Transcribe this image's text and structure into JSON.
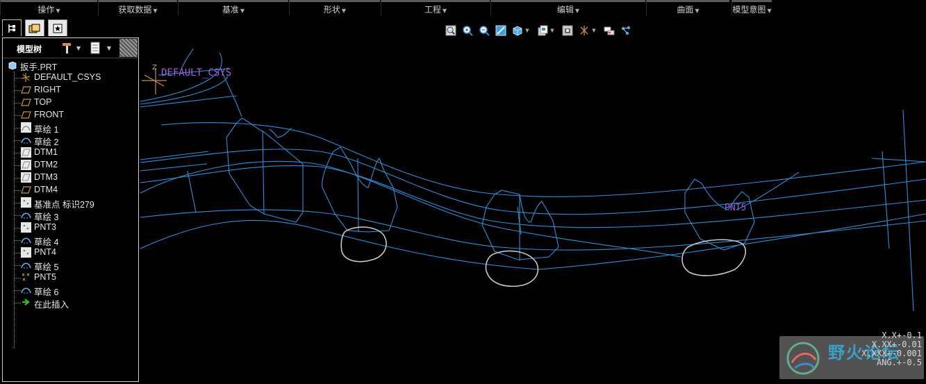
{
  "ribbon": {
    "groups": [
      "操作",
      "获取数据",
      "基准",
      "形状",
      "工程",
      "编辑",
      "曲面",
      "模型意图"
    ]
  },
  "nav": {
    "tabs": [
      "model-tree-tab",
      "folder-browser-tab",
      "favorites-tab"
    ]
  },
  "tree_toolbar": {
    "title": "模型树",
    "icons": [
      "settings-icon",
      "show-icon",
      "grid-icon"
    ]
  },
  "tree": {
    "items": [
      {
        "label": "扳手.PRT",
        "icon": "part-icon"
      },
      {
        "label": "DEFAULT_CSYS",
        "icon": "csys-icon"
      },
      {
        "label": "RIGHT",
        "icon": "datum-plane-icon"
      },
      {
        "label": "TOP",
        "icon": "datum-plane-icon"
      },
      {
        "label": "FRONT",
        "icon": "datum-plane-icon"
      },
      {
        "label": "草绘 1",
        "icon": "sketch-icon"
      },
      {
        "label": "草绘 2",
        "icon": "sketch-icon"
      },
      {
        "label": "DTM1",
        "icon": "datum-plane-icon"
      },
      {
        "label": "DTM2",
        "icon": "datum-plane-icon"
      },
      {
        "label": "DTM3",
        "icon": "datum-plane-icon"
      },
      {
        "label": "DTM4",
        "icon": "datum-plane-icon"
      },
      {
        "label": "基准点 标识279",
        "icon": "datum-point-icon"
      },
      {
        "label": "草绘 3",
        "icon": "sketch-icon"
      },
      {
        "label": "PNT3",
        "icon": "datum-point-icon"
      },
      {
        "label": "草绘 4",
        "icon": "sketch-icon"
      },
      {
        "label": "PNT4",
        "icon": "datum-point-icon"
      },
      {
        "label": "草绘 5",
        "icon": "sketch-icon"
      },
      {
        "label": "PNT5",
        "icon": "datum-point-icon"
      },
      {
        "label": "草绘 6",
        "icon": "sketch-icon"
      },
      {
        "label": "在此插入",
        "icon": "insert-here-icon"
      }
    ]
  },
  "graphics_toolbar": {
    "icons": [
      "refit-icon",
      "zoom-in-icon",
      "zoom-out-icon",
      "repaint-icon",
      "display-style-icon",
      "saved-views-icon",
      "view-manager-icon",
      "datum-display-icon",
      "spin-center-icon",
      "annotation-display-icon"
    ]
  },
  "canvas": {
    "csys_label": "DEFAULT_CSYS",
    "csys_axis": "Z",
    "point_label": "PNT5",
    "curve_color": "#2f8fd8",
    "sketch_color": "#c8c8c8",
    "label_color": "#a060e0"
  },
  "tolerance": {
    "lines": [
      "X.X+-0.1",
      "X.XX+-0.01",
      "X.XXX+-0.001",
      "ANG.+-0.5"
    ]
  },
  "watermark": {
    "text": "野火论坛"
  }
}
